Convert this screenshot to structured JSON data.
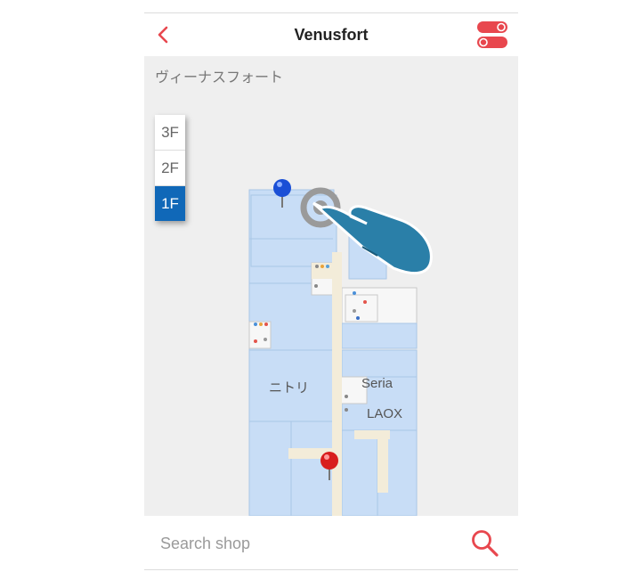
{
  "header": {
    "title": "Venusfort",
    "back_icon": "chevron-left-icon",
    "toggle_icon": "toggle-switches-icon"
  },
  "map": {
    "building_name": "ヴィーナスフォート",
    "floors": [
      {
        "label": "3F"
      },
      {
        "label": "2F"
      },
      {
        "label": "1F"
      }
    ],
    "selected_floor": "1F",
    "shop_labels": [
      {
        "name": "ニトリ"
      },
      {
        "name": "Seria"
      },
      {
        "name": "LAOX"
      }
    ],
    "pins": [
      {
        "color": "#1a4fd6",
        "icon": "blue-map-pin-icon"
      },
      {
        "color": "#d81e1e",
        "icon": "red-map-pin-icon"
      }
    ],
    "gesture": "tap-gesture-hand-icon",
    "colors": {
      "shop_fill": "#c8ddf6",
      "corridor": "#f3ecd9",
      "accent": "#e8474e",
      "active_floor": "#1068b8"
    }
  },
  "bottom": {
    "expand_icon": "chevron-up-icon",
    "search_placeholder": "Search shop",
    "search_icon": "magnifier-icon"
  }
}
